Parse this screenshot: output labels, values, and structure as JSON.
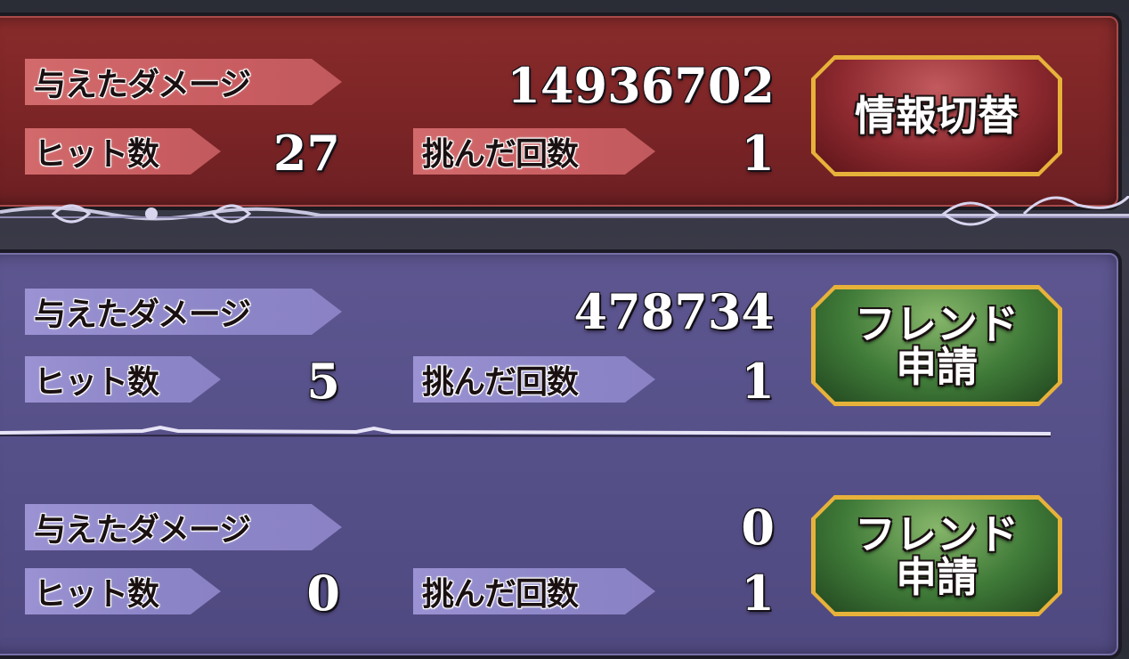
{
  "panels": [
    {
      "theme": "red",
      "damage_label": "与えたダメージ",
      "damage_value": "14936702",
      "hits_label": "ヒット数",
      "hits_value": "27",
      "tries_label": "挑んだ回数",
      "tries_value": "1",
      "button": {
        "line1": "情報切替",
        "line2": ""
      }
    },
    {
      "theme": "purple",
      "damage_label": "与えたダメージ",
      "damage_value": "478734",
      "hits_label": "ヒット数",
      "hits_value": "5",
      "tries_label": "挑んだ回数",
      "tries_value": "1",
      "button": {
        "line1": "フレンド",
        "line2": "申請"
      }
    },
    {
      "theme": "purple",
      "damage_label": "与えたダメージ",
      "damage_value": "0",
      "hits_label": "ヒット数",
      "hits_value": "0",
      "tries_label": "挑んだ回数",
      "tries_value": "1",
      "button": {
        "line1": "フレンド",
        "line2": "申請"
      }
    }
  ],
  "colors": {
    "red_panel": "#7a2426",
    "purple_panel": "#565089",
    "button_border_gold": "#e7b23a",
    "button_green": "#3f7a38",
    "button_red": "#8e2a30"
  }
}
